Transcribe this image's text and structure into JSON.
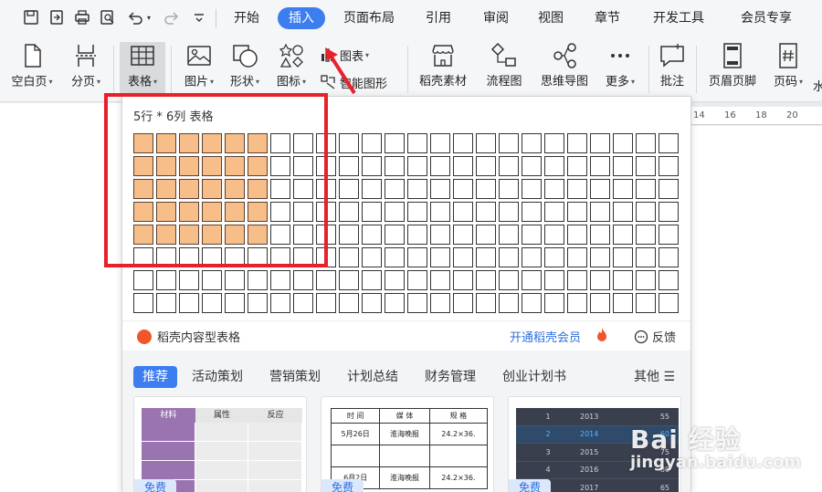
{
  "menu": {
    "tabs": [
      "开始",
      "插入",
      "页面布局",
      "引用",
      "审阅",
      "视图",
      "章节",
      "开发工具",
      "会员专享"
    ],
    "active_index": 1
  },
  "ribbon": {
    "blank_page": "空白页",
    "page_break": "分页",
    "table": "表格",
    "picture": "图片",
    "shapes": "形状",
    "icons": "图标",
    "chart": "图表",
    "smart_shape": "智能图形",
    "daoke_material": "稻壳素材",
    "flowchart": "流程图",
    "mindmap": "思维导图",
    "more": "更多",
    "comment": "批注",
    "header_footer": "页眉页脚",
    "page_number": "页码",
    "cut_off": "水"
  },
  "ruler": {
    "marks": [
      "14",
      "16",
      "18",
      "20"
    ]
  },
  "table_picker": {
    "title": "5行 * 6列 表格",
    "rows": 8,
    "cols": 24,
    "selected_rows": 5,
    "selected_cols": 6
  },
  "daoke": {
    "label": "稻壳内容型表格",
    "vip": "开通稻壳会员",
    "feedback": "反馈"
  },
  "categories": {
    "items": [
      "推荐",
      "活动策划",
      "营销策划",
      "计划总结",
      "财务管理",
      "创业计划书"
    ],
    "more": "其他 ☰"
  },
  "templates": {
    "free_label": "免费",
    "t1_headers": [
      "材料",
      "属性",
      "反应"
    ],
    "t2_headers": [
      "时 间",
      "媒 体",
      "规 格"
    ],
    "t2_rows": [
      [
        "5月26日",
        "淮海晚报",
        "24.2×36."
      ],
      [
        "6月2日",
        "淮海晚报",
        "24.2×36."
      ]
    ],
    "t3_rows": [
      [
        "1",
        "2013",
        "55"
      ],
      [
        "2",
        "2014",
        "60"
      ],
      [
        "3",
        "2015",
        "75"
      ],
      [
        "4",
        "2016",
        "80"
      ],
      [
        "5",
        "2017",
        "65"
      ]
    ]
  },
  "watermark": {
    "brand": "Bai 经验",
    "url": "jingyan.baidu.com"
  },
  "colors": {
    "accent": "#3c7df0",
    "selected_cell": "#f8be8a",
    "annotation": "#e8202a"
  }
}
